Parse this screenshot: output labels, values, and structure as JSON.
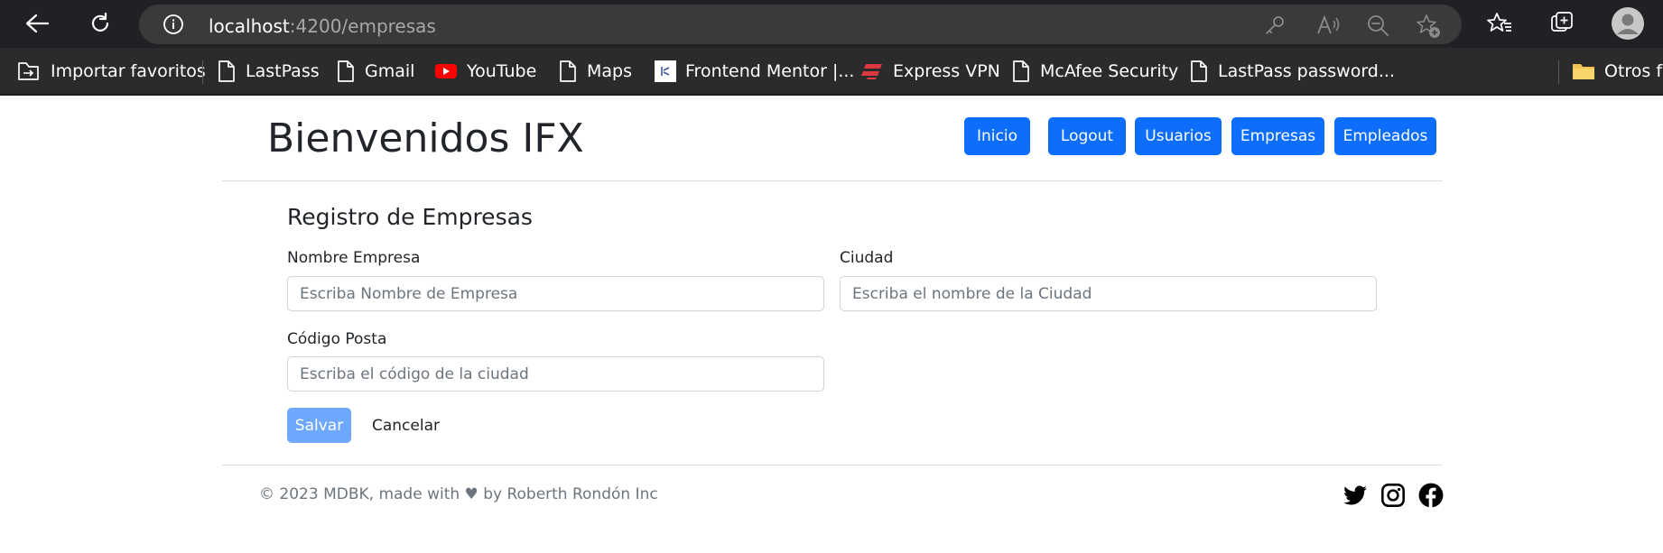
{
  "browser": {
    "url_host": "localhost",
    "url_rest": ":4200/empresas",
    "bookmarks": [
      {
        "label": "Importar favoritos",
        "icon": "import-icon"
      },
      {
        "label": "LastPass",
        "icon": "page-icon"
      },
      {
        "label": "Gmail",
        "icon": "page-icon"
      },
      {
        "label": "YouTube",
        "icon": "youtube-icon"
      },
      {
        "label": "Maps",
        "icon": "page-icon"
      },
      {
        "label": "Frontend Mentor |...",
        "icon": "frontend-mentor-icon"
      },
      {
        "label": "Express VPN",
        "icon": "expressvpn-icon"
      },
      {
        "label": "McAfee Security",
        "icon": "page-icon"
      },
      {
        "label": "LastPass password...",
        "icon": "page-icon"
      },
      {
        "label": "Otros fa",
        "icon": "folder-icon"
      }
    ]
  },
  "header": {
    "title": "Bienvenidos IFX",
    "nav": [
      "Inicio",
      "Logout",
      "Usuarios",
      "Empresas",
      "Empleados"
    ]
  },
  "form": {
    "title": "Registro de Empresas",
    "nombre_label": "Nombre Empresa",
    "nombre_placeholder": "Escriba Nombre de Empresa",
    "ciudad_label": "Ciudad",
    "ciudad_placeholder": "Escriba el nombre de la Ciudad",
    "codigo_label": "Código Posta",
    "codigo_placeholder": "Escriba el código de la ciudad",
    "save_label": "Salvar",
    "cancel_label": "Cancelar"
  },
  "footer": {
    "text": "© 2023 MDBK, made with ♥ by Roberth Rondón Inc",
    "social": [
      "twitter-icon",
      "instagram-icon",
      "facebook-icon"
    ]
  },
  "colors": {
    "primary": "#0d6efd",
    "primary_disabled": "#6ea8fe",
    "browser_dark": "#202124"
  }
}
